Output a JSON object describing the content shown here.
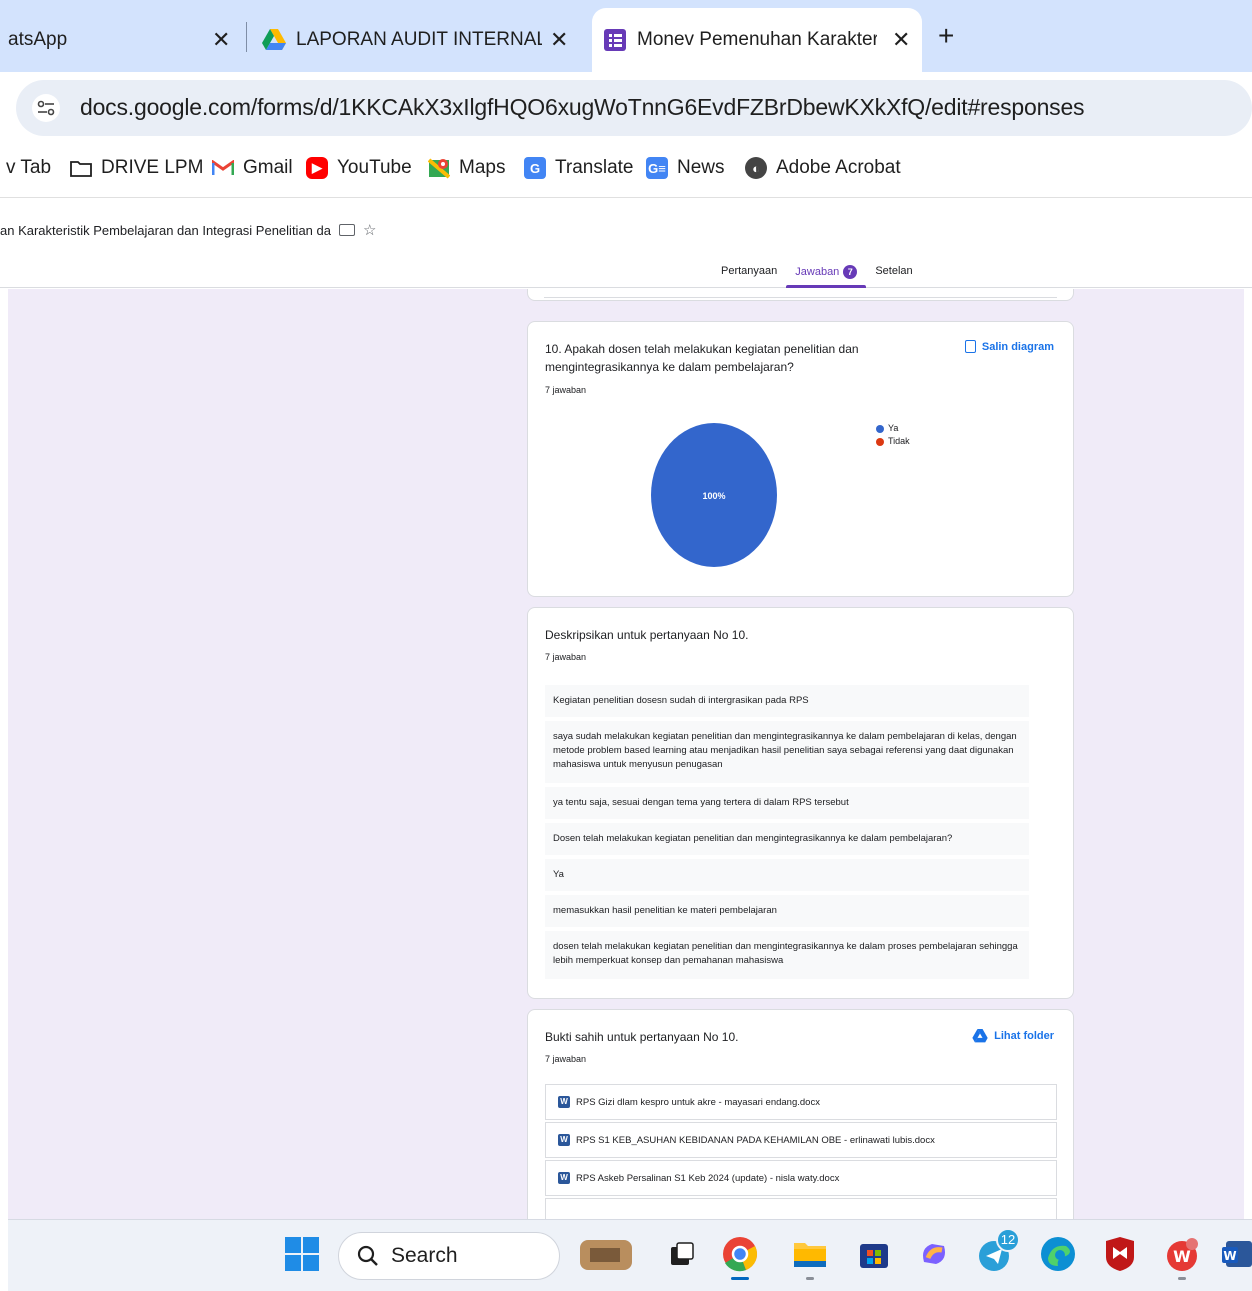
{
  "browser": {
    "tabs": [
      {
        "title": "atsApp",
        "active": false
      },
      {
        "title": "LAPORAN AUDIT INTERNAL RE",
        "active": false
      },
      {
        "title": "Monev Pemenuhan Karakteristi",
        "active": true
      }
    ],
    "address": "docs.google.com/forms/d/1KKCAkX3xIlgfHQO6xugWoTnnG6EvdFZBrDbewKXkXfQ/edit#responses",
    "bookmarks": [
      {
        "label": "v Tab",
        "icon": "none"
      },
      {
        "label": "DRIVE LPM",
        "icon": "folder-icon"
      },
      {
        "label": "Gmail",
        "icon": "gmail-icon"
      },
      {
        "label": "YouTube",
        "icon": "youtube-icon"
      },
      {
        "label": "Maps",
        "icon": "maps-icon"
      },
      {
        "label": "Translate",
        "icon": "translate-icon"
      },
      {
        "label": "News",
        "icon": "news-icon"
      },
      {
        "label": "Adobe Acrobat",
        "icon": "acrobat-icon"
      }
    ]
  },
  "form": {
    "title": "an Karakteristik Pembelajaran dan Integrasi Penelitian da",
    "tabs": {
      "questions": "Pertanyaan",
      "responses": "Jawaban",
      "responses_badge": "7",
      "settings": "Setelan"
    }
  },
  "q10": {
    "title": "10. Apakah dosen telah melakukan kegiatan penelitian dan mengintegrasikannya ke dalam pembelajaran?",
    "count": "7 jawaban",
    "copy_label": "Salin diagram",
    "chart_data": {
      "type": "pie",
      "categories": [
        "Ya",
        "Tidak"
      ],
      "values": [
        100,
        0
      ],
      "colors": [
        "#3366cc",
        "#dc3912"
      ],
      "slice_label": "100%",
      "legend": "top-right"
    }
  },
  "desc10": {
    "title": "Deskripsikan untuk pertanyaan No 10.",
    "count": "7 jawaban",
    "responses": [
      "Kegiatan penelitian dosesn sudah di intergrasikan pada RPS",
      "saya sudah melakukan kegiatan penelitian dan mengintegrasikannya ke dalam pembelajaran di kelas, dengan metode problem based learning atau menjadikan hasil penelitian saya sebagai referensi yang daat digunakan mahasiswa untuk menyusun penugasan",
      "ya tentu saja, sesuai dengan tema yang tertera di dalam RPS tersebut",
      "Dosen telah melakukan kegiatan penelitian dan mengintegrasikannya ke dalam pembelajaran?",
      "Ya",
      "memasukkan hasil penelitian ke materi pembelajaran",
      "dosen telah melakukan kegiatan penelitian dan mengintegrasikannya ke dalam proses pembelajaran sehingga lebih memperkuat konsep dan pemahanan mahasiswa"
    ]
  },
  "evidence10": {
    "title": "Bukti sahih untuk pertanyaan No 10.",
    "count": "7 jawaban",
    "folder_label": "Lihat folder",
    "files": [
      "RPS Gizi dlam kespro untuk akre - mayasari endang.docx",
      "RPS S1 KEB_ASUHAN KEBIDANAN PADA KEHAMILAN OBE - erlinawati lubis.docx",
      "RPS Askeb Persalinan S1 Keb 2024 (update) - nisla waty.docx"
    ]
  },
  "taskbar": {
    "search_label": "Search",
    "telegram_badge": "12"
  }
}
